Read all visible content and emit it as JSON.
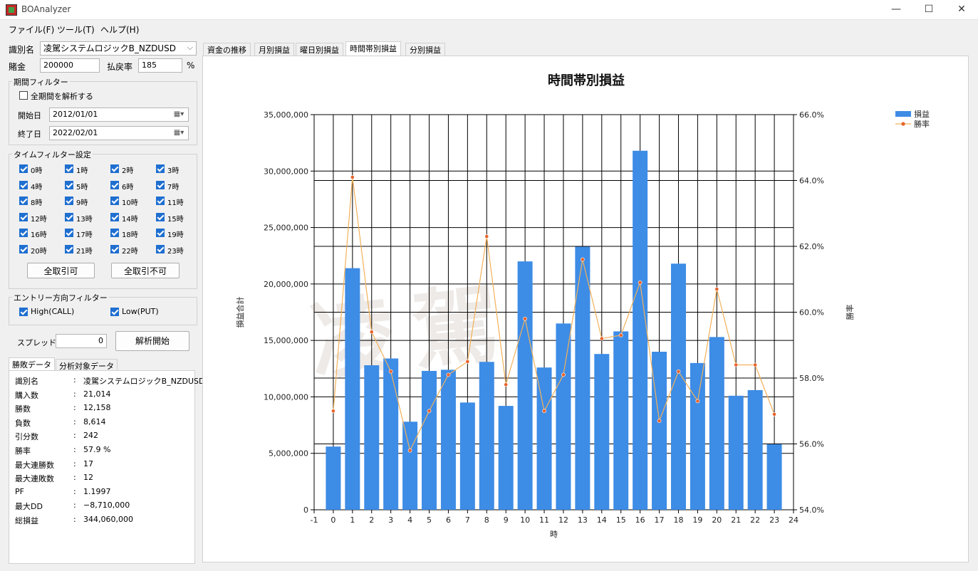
{
  "window": {
    "title": "BOAnalyzer",
    "minimize": "—",
    "maximize": "☐",
    "close": "✕"
  },
  "menu": [
    "ファイル(F)",
    "ツール(T)",
    "ヘルプ(H)"
  ],
  "left": {
    "id_label": "識別名",
    "id_value": "凌駕システムロジックB_NZDUSD",
    "stake_label": "賭金",
    "stake_value": "200000",
    "payout_label": "払戻率",
    "payout_value": "185",
    "payout_unit": "%",
    "period_group": "期間フィルター",
    "period_all_label": "全期間を解析する",
    "period_all_checked": false,
    "start_label": "開始日",
    "start_value": "2012/01/01",
    "end_label": "終了日",
    "end_value": "2022/02/01",
    "time_group": "タイムフィルター設定",
    "hours": [
      "0時",
      "1時",
      "2時",
      "3時",
      "4時",
      "5時",
      "6時",
      "7時",
      "8時",
      "9時",
      "10時",
      "11時",
      "12時",
      "13時",
      "14時",
      "15時",
      "16時",
      "17時",
      "18時",
      "19時",
      "20時",
      "21時",
      "22時",
      "23時"
    ],
    "all_allow": "全取引可",
    "all_deny": "全取引不可",
    "entry_group": "エントリー方向フィルター",
    "high_label": "High(CALL)",
    "low_label": "Low(PUT)",
    "spread_label": "スプレッド",
    "spread_value": "0",
    "analyze_button": "解析開始",
    "tabs": [
      "勝敗データ",
      "分析対象データ"
    ],
    "stats": [
      {
        "k": "識別名",
        "v": "凌駕システムロジックB_NZDUSD"
      },
      {
        "k": "購入数",
        "v": "21,014"
      },
      {
        "k": "勝数",
        "v": "12,158"
      },
      {
        "k": "負数",
        "v": "8,614"
      },
      {
        "k": "引分数",
        "v": "242"
      },
      {
        "k": "勝率",
        "v": "57.9 %"
      },
      {
        "k": "最大連勝数",
        "v": "17"
      },
      {
        "k": "最大連敗数",
        "v": "12"
      },
      {
        "k": "PF",
        "v": "1.1997"
      },
      {
        "k": "最大DD",
        "v": "−8,710,000"
      },
      {
        "k": "総損益",
        "v": "344,060,000"
      }
    ],
    "colon": ":"
  },
  "right_tabs": [
    "資金の推移",
    "月別損益",
    "曜日別損益",
    "時間帯別損益",
    "分別損益"
  ],
  "colors": {
    "bar": "#3d8ce6",
    "line": "#f2b15a",
    "marker": "#e8622a"
  },
  "chart_data": {
    "type": "bar",
    "title": "時間帯別損益",
    "xlabel": "時",
    "ylabel": "損益合計",
    "y2label": "勝率",
    "legend_position": "top-right",
    "grid": true,
    "x": [
      0,
      1,
      2,
      3,
      4,
      5,
      6,
      7,
      8,
      9,
      10,
      11,
      12,
      13,
      14,
      15,
      16,
      17,
      18,
      19,
      20,
      21,
      22,
      23
    ],
    "xlim": [
      -1,
      24
    ],
    "xticks": [
      "-1",
      "0",
      "1",
      "2",
      "3",
      "4",
      "5",
      "6",
      "7",
      "8",
      "9",
      "10",
      "11",
      "12",
      "13",
      "14",
      "15",
      "16",
      "17",
      "18",
      "19",
      "20",
      "21",
      "22",
      "23",
      "24"
    ],
    "ylim": [
      0,
      35000000
    ],
    "yticks": [
      "0",
      "5,000,000",
      "10,000,000",
      "15,000,000",
      "20,000,000",
      "25,000,000",
      "30,000,000",
      "35,000,000"
    ],
    "y2lim": [
      54,
      66
    ],
    "y2ticks": [
      "54.0%",
      "56.0%",
      "58.0%",
      "60.0%",
      "62.0%",
      "64.0%",
      "66.0%"
    ],
    "series": [
      {
        "name": "損益",
        "type": "bar",
        "axis": "left",
        "values": [
          5600000,
          21400000,
          12800000,
          13400000,
          7800000,
          12300000,
          12400000,
          9500000,
          13100000,
          9200000,
          22000000,
          12600000,
          16500000,
          23300000,
          13800000,
          15800000,
          31800000,
          14000000,
          21800000,
          13000000,
          15300000,
          10100000,
          10600000,
          5800000
        ]
      },
      {
        "name": "勝率",
        "type": "line",
        "axis": "right",
        "values": [
          57.0,
          64.1,
          59.4,
          58.2,
          55.8,
          57.0,
          58.1,
          58.5,
          62.3,
          57.8,
          59.8,
          57.0,
          58.1,
          61.6,
          59.2,
          59.3,
          60.9,
          56.7,
          58.2,
          57.3,
          60.7,
          58.4,
          58.4,
          56.9
        ]
      }
    ]
  }
}
